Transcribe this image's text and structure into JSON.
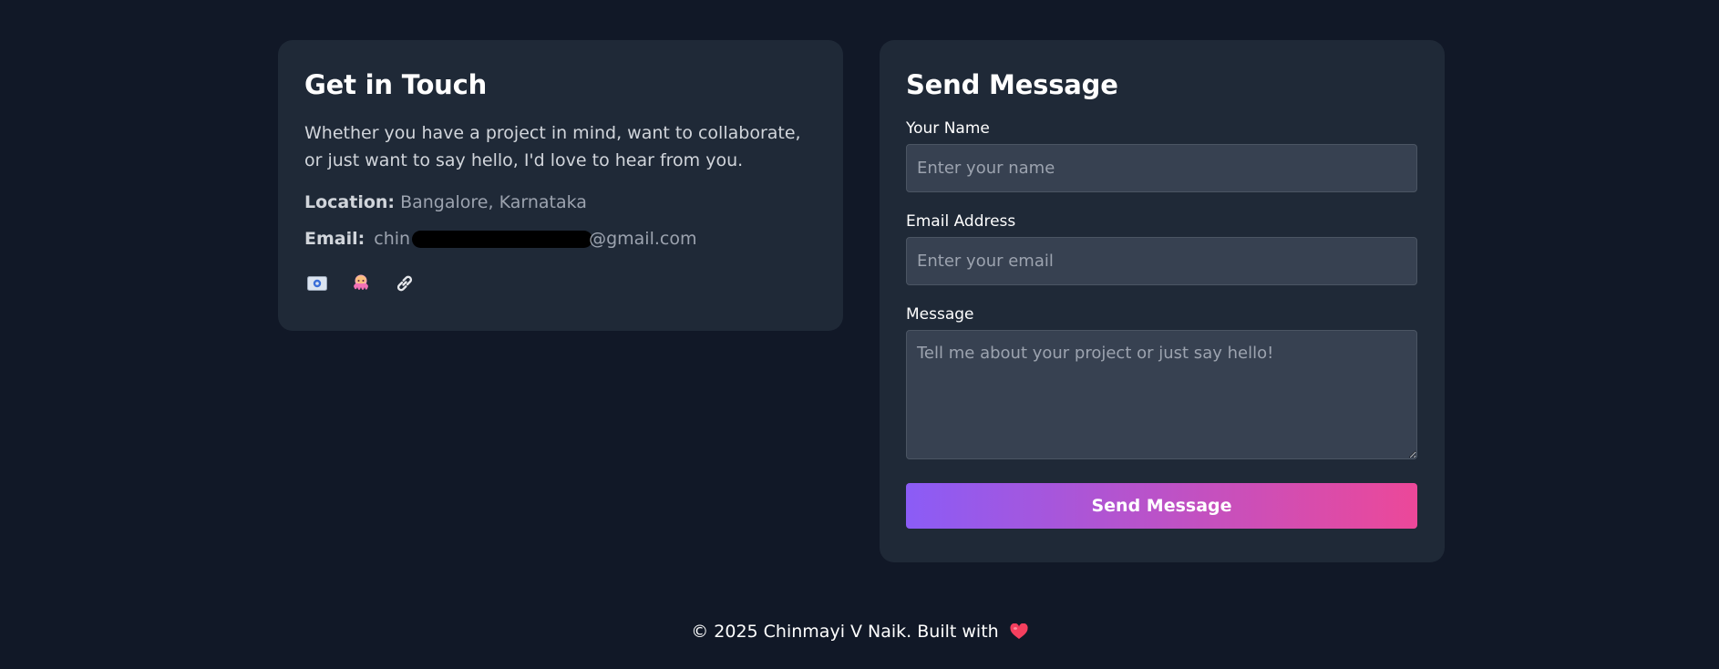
{
  "contact": {
    "title": "Get in Touch",
    "intro": "Whether you have a project in mind, want to collaborate, or just want to say hello, I'd love to hear from you.",
    "location_label": "Location:",
    "location_value": "Bangalore, Karnataka",
    "email_label": "Email:",
    "email_value_prefix": "chin",
    "email_value_suffix": "@gmail.com",
    "socials": [
      {
        "icon": "email-icon"
      },
      {
        "icon": "octopus-icon"
      },
      {
        "icon": "link-icon"
      }
    ]
  },
  "form": {
    "title": "Send Message",
    "name_label": "Your Name",
    "name_placeholder": "Enter your name",
    "email_label": "Email Address",
    "email_placeholder": "Enter your email",
    "message_label": "Message",
    "message_placeholder": "Tell me about your project or just say hello!",
    "submit_label": "Send Message"
  },
  "footer": {
    "text": "© 2025 Chinmayi V Naik. Built with",
    "icon": "heart-icon"
  },
  "colors": {
    "background": "#111827",
    "card": "#1f2937",
    "input": "#374151",
    "gradient_start": "#8b5cf6",
    "gradient_end": "#ec4899",
    "heart": "#f43f5e"
  }
}
